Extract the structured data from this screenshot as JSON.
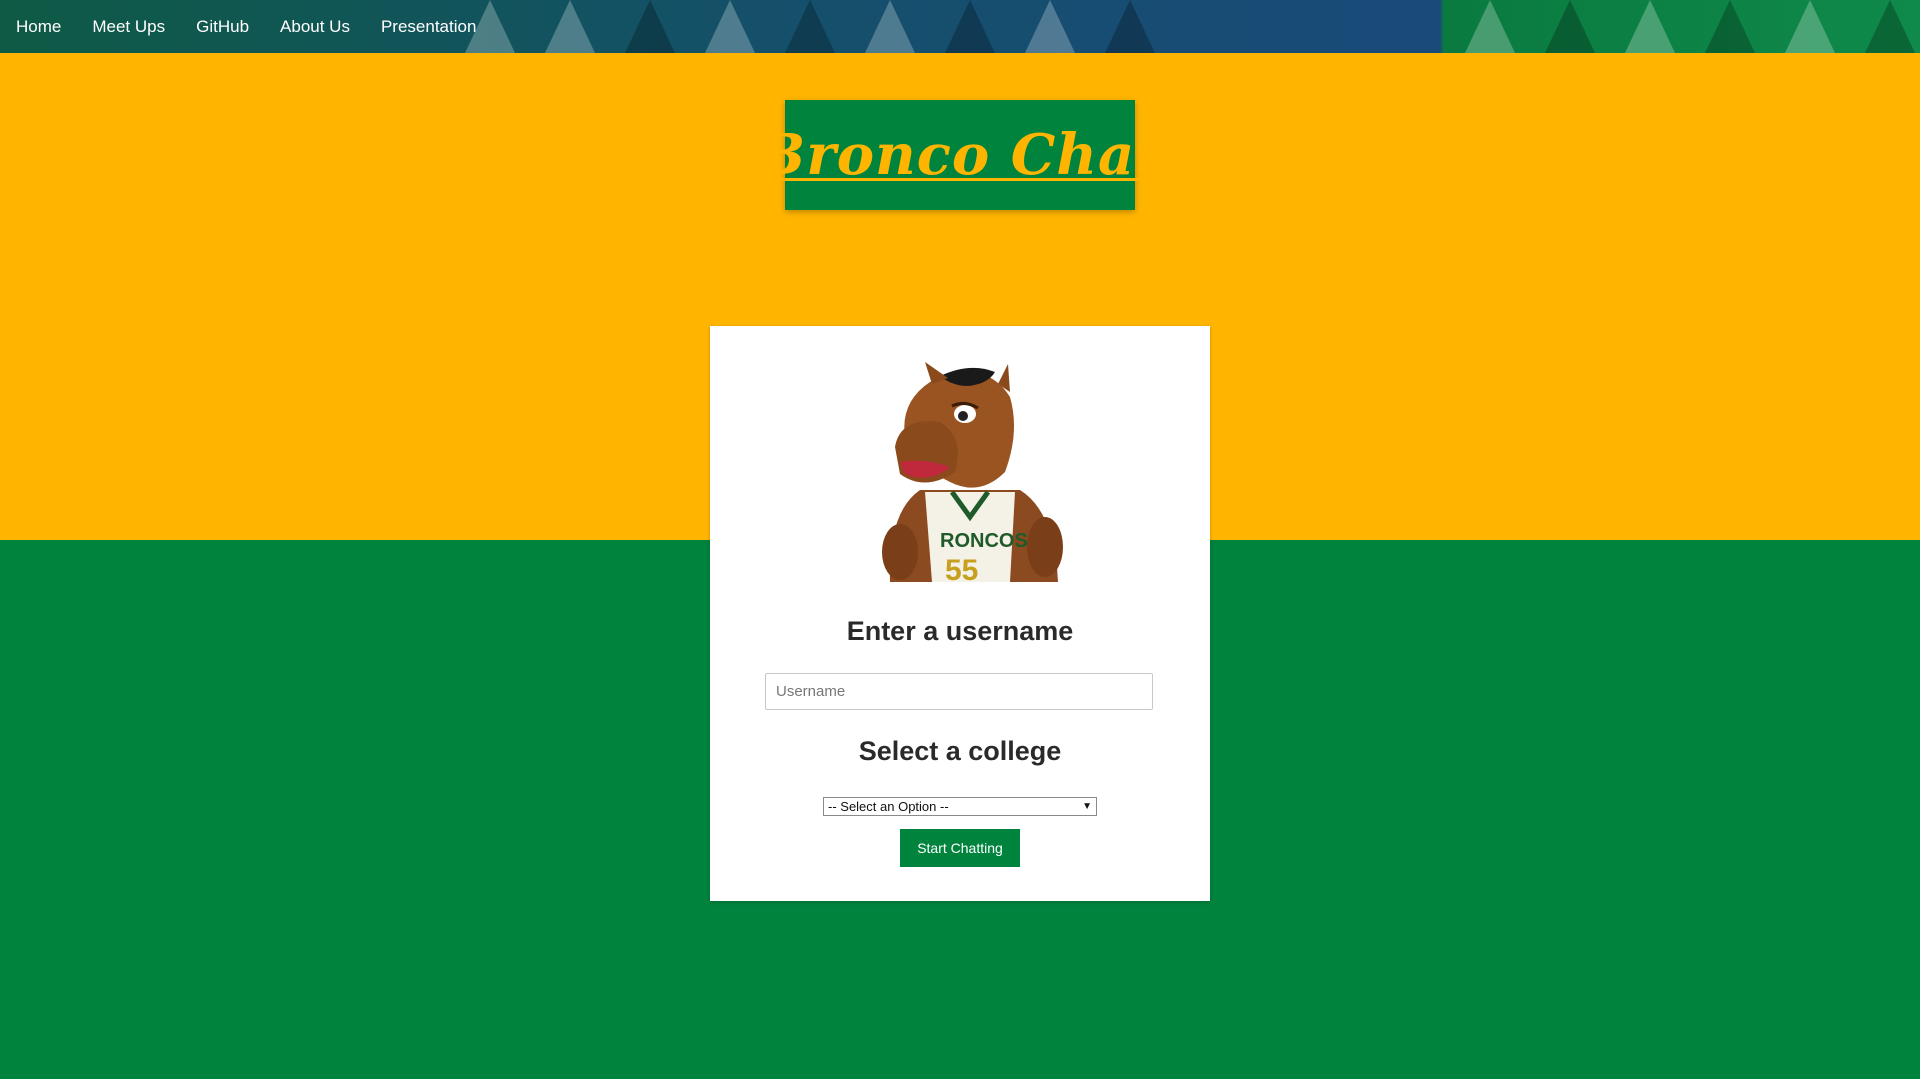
{
  "nav": {
    "items": [
      {
        "label": "Home"
      },
      {
        "label": "Meet Ups"
      },
      {
        "label": "GitHub"
      },
      {
        "label": "About Us"
      },
      {
        "label": "Presentation"
      }
    ]
  },
  "logo": {
    "text": "Bronco Chat"
  },
  "card": {
    "mascot_icon": "bronco-mascot-image",
    "username_heading": "Enter a username",
    "username_placeholder": "Username",
    "college_heading": "Select a college",
    "college_select_value": "-- Select an Option --",
    "start_button": "Start Chatting"
  },
  "colors": {
    "yellow": "#ffb500",
    "green": "#00843d",
    "white": "#ffffff"
  }
}
